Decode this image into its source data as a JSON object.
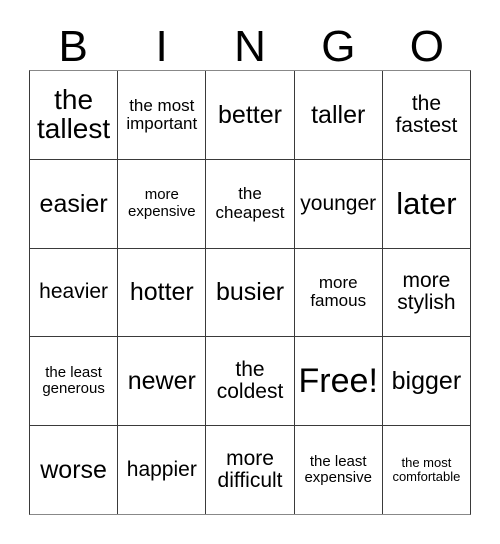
{
  "card": {
    "title": "BINGO",
    "header_letters": [
      "B",
      "I",
      "N",
      "G",
      "O"
    ],
    "free_space_label": "Free!",
    "colors": {
      "background": "#ffffff",
      "text": "#000000",
      "grid_line": "#3a3a3a",
      "grid_outer_line": "#888888"
    },
    "rows": [
      [
        {
          "text": "the tallest",
          "size": "lg"
        },
        {
          "text": "the most important",
          "size": "xs"
        },
        {
          "text": "better",
          "size": "md"
        },
        {
          "text": "taller",
          "size": "md"
        },
        {
          "text": "the fastest",
          "size": "sm"
        }
      ],
      [
        {
          "text": "easier",
          "size": "md"
        },
        {
          "text": "more expensive",
          "size": "xxs"
        },
        {
          "text": "the cheapest",
          "size": "xs"
        },
        {
          "text": "younger",
          "size": "sm"
        },
        {
          "text": "later",
          "size": "xl"
        }
      ],
      [
        {
          "text": "heavier",
          "size": "sm"
        },
        {
          "text": "hotter",
          "size": "md"
        },
        {
          "text": "busier",
          "size": "md"
        },
        {
          "text": "more famous",
          "size": "xs"
        },
        {
          "text": "more stylish",
          "size": "sm"
        }
      ],
      [
        {
          "text": "the least generous",
          "size": "xxs"
        },
        {
          "text": "newer",
          "size": "md"
        },
        {
          "text": "the coldest",
          "size": "sm"
        },
        {
          "text": "Free!",
          "size": "xxl"
        },
        {
          "text": "bigger",
          "size": "md"
        }
      ],
      [
        {
          "text": "worse",
          "size": "md"
        },
        {
          "text": "happier",
          "size": "sm"
        },
        {
          "text": "more difficult",
          "size": "sm"
        },
        {
          "text": "the least expensive",
          "size": "xxs"
        },
        {
          "text": "the most comfortable",
          "size": "tiny"
        }
      ]
    ]
  }
}
